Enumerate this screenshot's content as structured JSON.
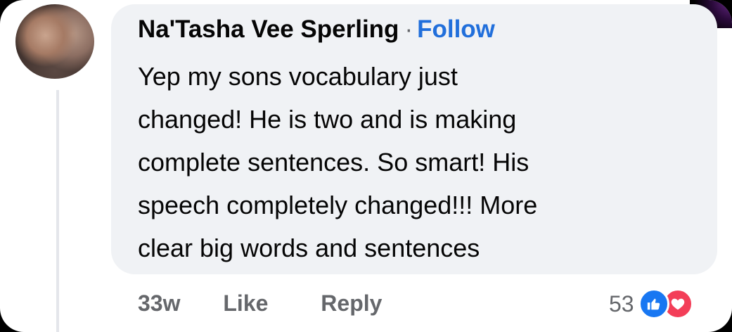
{
  "comment": {
    "author": "Na'Tasha Vee Sperling",
    "separator": "·",
    "follow_label": "Follow",
    "text": "Yep my sons vocabulary just\nchanged! He is two and is making\ncomplete sentences. So smart! His\nspeech completely changed!!! More\nclear big words and sentences",
    "timestamp": "33w",
    "like_label": "Like",
    "reply_label": "Reply",
    "reaction_count": "53",
    "reactions": [
      "like-icon",
      "love-icon"
    ]
  },
  "colors": {
    "bubble": "#f0f2f5",
    "follow": "#216fdb",
    "meta": "#65676b",
    "like_reaction": "#1877f2",
    "love_reaction": "#f33e58"
  }
}
